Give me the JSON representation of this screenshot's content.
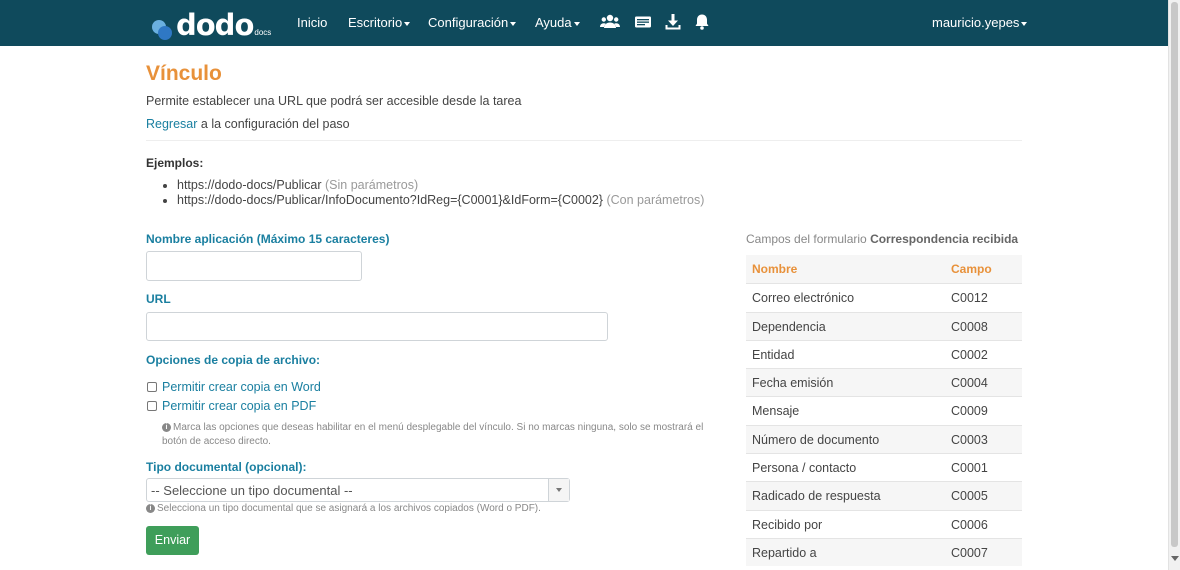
{
  "navbar": {
    "logo_text": "dodo",
    "logo_sub": "docs",
    "menu": [
      {
        "label": "Inicio"
      },
      {
        "label": "Escritorio"
      },
      {
        "label": "Configuración"
      },
      {
        "label": "Ayuda"
      }
    ],
    "icons": [
      "users-icon",
      "id-card-icon",
      "download-icon",
      "bell-icon"
    ],
    "user": "mauricio.yepes"
  },
  "page": {
    "title": "Vínculo",
    "description": "Permite establecer una URL que podrá ser accesible desde la tarea",
    "back_link": "Regresar",
    "back_rest": " a la configuración del paso"
  },
  "examples": {
    "heading": "Ejemplos:",
    "items": [
      {
        "url": "https://dodo-docs/Publicar",
        "note": "(Sin parámetros)"
      },
      {
        "url": "https://dodo-docs/Publicar/InfoDocumento?IdReg={C0001}&IdForm={C0002}",
        "note": "(Con parámetros)"
      }
    ]
  },
  "form": {
    "app_name_label": "Nombre aplicación (Máximo 15 caracteres)",
    "app_name_value": "",
    "url_label": "URL",
    "url_value": "",
    "copy_label": "Opciones de copia de archivo:",
    "copy_word": "Permitir crear copia en Word",
    "copy_pdf": "Permitir crear copia en PDF",
    "copy_help": "Marca las opciones que deseas habilitar en el menú desplegable del vínculo. Si no marcas ninguna, solo se mostrará el botón de acceso directo.",
    "doctype_label": "Tipo documental (opcional):",
    "doctype_selected": "-- Seleccione un tipo documental --",
    "doctype_help": "Selecciona un tipo documental que se asignará a los archivos copiados (Word o PDF).",
    "submit": "Enviar"
  },
  "fields_table": {
    "caption_prefix": "Campos del formulario ",
    "caption_form": "Correspondencia recibida",
    "headers": {
      "name": "Nombre",
      "code": "Campo"
    },
    "rows": [
      {
        "name": "Correo electrónico",
        "code": "C0012"
      },
      {
        "name": "Dependencia",
        "code": "C0008"
      },
      {
        "name": "Entidad",
        "code": "C0002"
      },
      {
        "name": "Fecha emisión",
        "code": "C0004"
      },
      {
        "name": "Mensaje",
        "code": "C0009"
      },
      {
        "name": "Número de documento",
        "code": "C0003"
      },
      {
        "name": "Persona / contacto",
        "code": "C0001"
      },
      {
        "name": "Radicado de respuesta",
        "code": "C0005"
      },
      {
        "name": "Recibido por",
        "code": "C0006"
      },
      {
        "name": "Repartido a",
        "code": "C0007"
      }
    ]
  },
  "colors": {
    "navbar": "#0f4a5c",
    "title": "#e8913a",
    "link": "#1a7fa0",
    "button": "#3f9e5a"
  }
}
